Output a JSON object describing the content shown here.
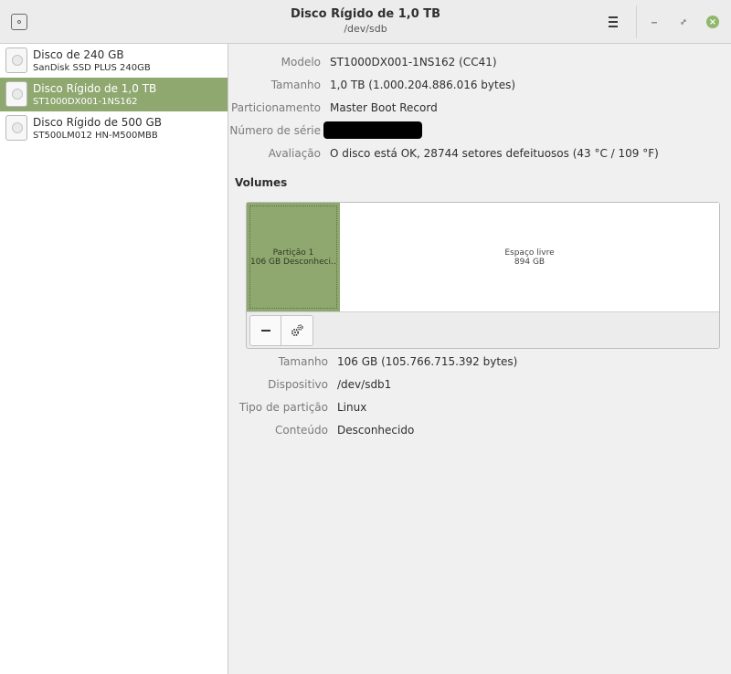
{
  "header": {
    "title": "Disco Rígido de 1,0 TB",
    "subtitle": "/dev/sdb"
  },
  "sidebar": {
    "items": [
      {
        "name": "Disco de 240 GB",
        "model": "SanDisk SSD PLUS 240GB",
        "selected": false
      },
      {
        "name": "Disco Rígido de 1,0 TB",
        "model": "ST1000DX001-1NS162",
        "selected": true
      },
      {
        "name": "Disco Rígido de 500 GB",
        "model": "ST500LM012 HN-M500MBB",
        "selected": false
      }
    ]
  },
  "disk": {
    "model_label": "Modelo",
    "model_value": "ST1000DX001-1NS162 (CC41)",
    "size_label": "Tamanho",
    "size_value": "1,0 TB (1.000.204.886.016 bytes)",
    "partitioning_label": "Particionamento",
    "partitioning_value": "Master Boot Record",
    "serial_label": "Número de série",
    "assessment_label": "Avaliação",
    "assessment_value": "O disco está OK, 28744 setores defeituosos (43 °C / 109 °F)"
  },
  "volumes": {
    "heading": "Volumes",
    "partition_name": "Partição 1",
    "partition_desc": "106 GB Desconheci…",
    "free_name": "Espaço livre",
    "free_size": "894 GB",
    "remove_icon": "minus-icon",
    "settings_icon": "gears-icon"
  },
  "partition": {
    "size_label": "Tamanho",
    "size_value": "106 GB (105.766.715.392 bytes)",
    "device_label": "Dispositivo",
    "device_value": "/dev/sdb1",
    "type_label": "Tipo de partição",
    "type_value": "Linux",
    "content_label": "Conteúdo",
    "content_value": "Desconhecido"
  },
  "colors": {
    "accent": "#8fa870",
    "close": "#8fb86a"
  }
}
